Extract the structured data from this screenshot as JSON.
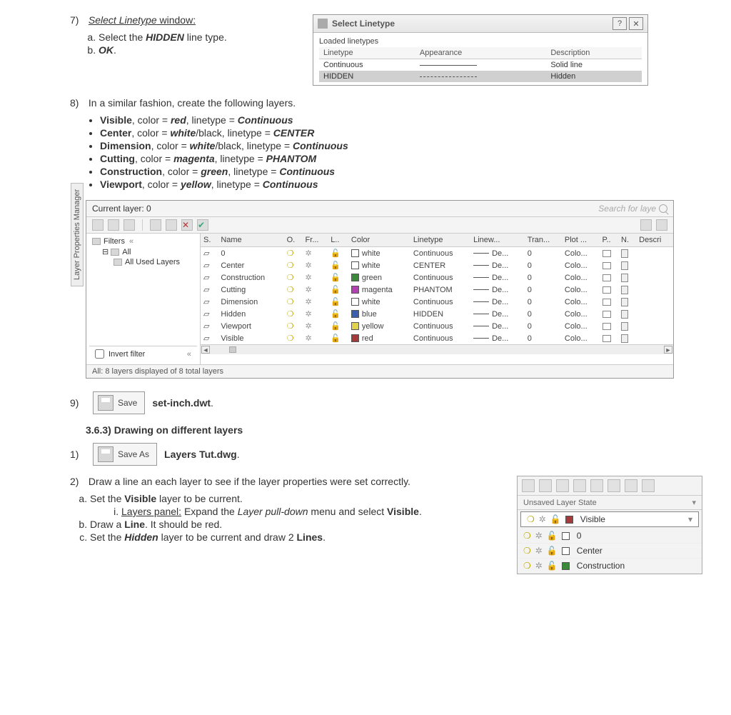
{
  "step7": {
    "num": "7)",
    "title_prefix": "Select Linetype",
    "title_suffix": " window:",
    "a_prefix": "Select the ",
    "a_hidden": "HIDDEN",
    "a_suffix": " line type.",
    "b": "OK"
  },
  "linetype_dialog": {
    "title": "Select Linetype",
    "help": "?",
    "close": "✕",
    "group": "Loaded linetypes",
    "cols": {
      "c1": "Linetype",
      "c2": "Appearance",
      "c3": "Description"
    },
    "rows": [
      {
        "name": "Continuous",
        "desc": "Solid line",
        "style": "solid"
      },
      {
        "name": "HIDDEN",
        "desc": "Hidden",
        "style": "dash",
        "selected": true
      }
    ]
  },
  "step8": {
    "num": "8)",
    "intro": "In a similar fashion, create the following layers.",
    "items": [
      {
        "pre": "Visible",
        "mid1": ", color = ",
        "v1": "red",
        "mid2": ", linetype = ",
        "v2": "Continuous"
      },
      {
        "pre": "Center",
        "mid1": ", color = ",
        "v1": "white",
        "v1b": "/black, linetype = ",
        "v2": "CENTER"
      },
      {
        "pre": "Dimension",
        "mid1": ", color = ",
        "v1": "white",
        "v1b": "/black, linetype = ",
        "v2": "Continuous"
      },
      {
        "pre": "Cutting",
        "mid1": ", color = ",
        "v1": "magenta",
        "mid2": ", linetype = ",
        "v2": "PHANTOM"
      },
      {
        "pre": "Construction",
        "mid1": ", color = ",
        "v1": "green",
        "mid2": ", linetype = ",
        "v2": "Continuous"
      },
      {
        "pre": "Viewport",
        "mid1": ", color = ",
        "v1": "yellow",
        "mid2": ", linetype = ",
        "v2": "Continuous"
      }
    ]
  },
  "layer_panel": {
    "side_label": "Layer Properties Manager",
    "current": "Current layer: 0",
    "search_placeholder": "Search for laye",
    "tree": {
      "filters": "Filters",
      "all": "All",
      "used": "All Used Layers"
    },
    "invert": "Invert filter",
    "status": "All: 8 layers displayed of 8 total layers",
    "cols": [
      "S.",
      "Name",
      "O.",
      "Fr...",
      "L..",
      "Color",
      "Linetype",
      "Linew...",
      "Tran...",
      "Plot ...",
      "P..",
      "N.",
      "Descri"
    ],
    "rows": [
      {
        "name": "0",
        "color": "white",
        "sw": "c-white",
        "lt": "Continuous",
        "lw": "De...",
        "tr": "0",
        "plot": "Colo..."
      },
      {
        "name": "Center",
        "color": "white",
        "sw": "c-white",
        "lt": "CENTER",
        "lw": "De...",
        "tr": "0",
        "plot": "Colo..."
      },
      {
        "name": "Construction",
        "color": "green",
        "sw": "c-green",
        "lt": "Continuous",
        "lw": "De...",
        "tr": "0",
        "plot": "Colo..."
      },
      {
        "name": "Cutting",
        "color": "magenta",
        "sw": "c-magenta",
        "lt": "PHANTOM",
        "lw": "De...",
        "tr": "0",
        "plot": "Colo..."
      },
      {
        "name": "Dimension",
        "color": "white",
        "sw": "c-white",
        "lt": "Continuous",
        "lw": "De...",
        "tr": "0",
        "plot": "Colo..."
      },
      {
        "name": "Hidden",
        "color": "blue",
        "sw": "c-blue",
        "lt": "HIDDEN",
        "lw": "De...",
        "tr": "0",
        "plot": "Colo..."
      },
      {
        "name": "Viewport",
        "color": "yellow",
        "sw": "c-yellow",
        "lt": "Continuous",
        "lw": "De...",
        "tr": "0",
        "plot": "Colo..."
      },
      {
        "name": "Visible",
        "color": "red",
        "sw": "c-red",
        "lt": "Continuous",
        "lw": "De...",
        "tr": "0",
        "plot": "Colo..."
      }
    ]
  },
  "step9": {
    "num": "9)",
    "btn": "Save",
    "file_pre": "set-inch",
    "file_ext": ".dwt",
    "dot": "."
  },
  "section": "3.6.3) Drawing on different layers",
  "step1": {
    "num": "1)",
    "btn": "Save As",
    "file_pre": "Layers Tut",
    "file_ext": ".dwg",
    "dot": "."
  },
  "step2": {
    "num": "2)",
    "intro": "Draw a line an each layer to see if the layer properties were set correctly.",
    "a_pre": "Set the ",
    "a_b": "Visible",
    "a_suf": " layer to be current.",
    "i_pre": "Layers panel:",
    "i_mid": "  Expand the ",
    "i_it": "Layer pull-down",
    "i_suf": " menu and select ",
    "i_b2": "Visible",
    "i_dot": ".",
    "b_pre": "Draw a ",
    "b_b": "Line",
    "b_suf": ".  It should be red.",
    "c_pre": "Set the ",
    "c_b": "Hidden",
    "c_mid": " layer to be current and draw 2 ",
    "c_b2": "Lines",
    "c_dot": "."
  },
  "flyout": {
    "state": "Unsaved Layer State",
    "rows": [
      {
        "label": "Visible",
        "sw": "c-red",
        "selected": true
      },
      {
        "label": "0",
        "sw": "c-white"
      },
      {
        "label": "Center",
        "sw": "c-white"
      },
      {
        "label": "Construction",
        "sw": "c-green"
      }
    ]
  }
}
